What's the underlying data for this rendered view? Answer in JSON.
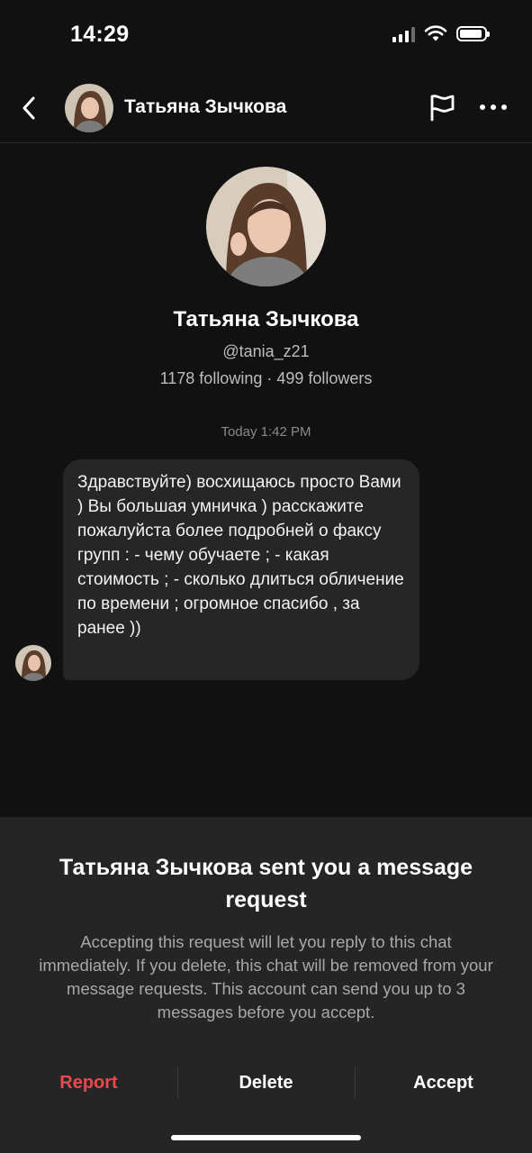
{
  "status_bar": {
    "time": "14:29"
  },
  "header": {
    "back_icon": "chevron-left-icon",
    "name": "Татьяна Зычкова",
    "flag_icon": "flag-icon",
    "more_icon": "more-dots-icon"
  },
  "profile": {
    "name": "Татьяна Зычкова",
    "handle": "@tania_z21",
    "stats": "1178 following · 499 followers"
  },
  "conversation": {
    "timestamp": "Today 1:42 PM",
    "messages": [
      {
        "text": "Здравствуйте) восхищаюсь просто Вами ) Вы большая умничка ) расскажите пожалуйста более подробней о факсу групп : - чему обучаете ; - какая стоимость ; - сколько длиться обличение по времени ; огромное спасибо , за ранее ))"
      }
    ]
  },
  "request_sheet": {
    "title": "Татьяна Зычкова sent you a message request",
    "description": "Accepting this request will let you reply to this chat immediately. If you delete, this chat will be removed from your message requests. This account can send you up to 3 messages before you accept.",
    "actions": {
      "report": "Report",
      "delete": "Delete",
      "accept": "Accept"
    }
  },
  "colors": {
    "background": "#111111",
    "sheet": "#252525",
    "bubble": "#262626",
    "report": "#f0474c",
    "muted": "#a8a8a8"
  }
}
